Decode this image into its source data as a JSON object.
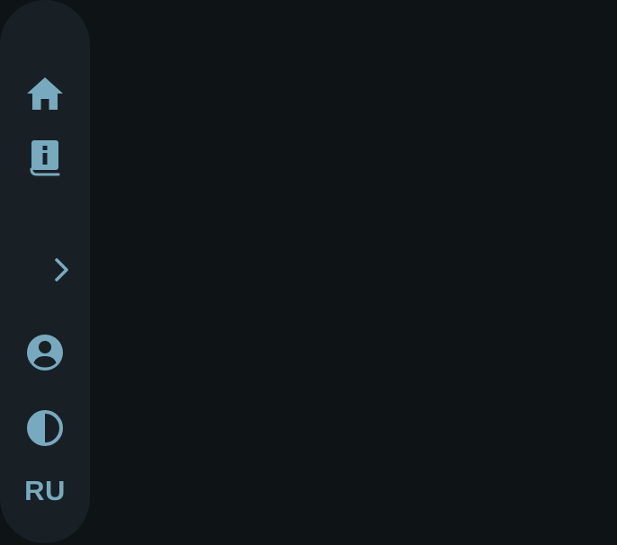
{
  "sidebar": {
    "items": [
      {
        "id": "home",
        "icon": "home-icon"
      },
      {
        "id": "info",
        "icon": "info-book-icon"
      },
      {
        "id": "expand",
        "icon": "chevron-right-icon"
      },
      {
        "id": "account",
        "icon": "account-circle-icon"
      },
      {
        "id": "theme",
        "icon": "contrast-icon"
      }
    ],
    "language": {
      "label": "RU"
    }
  },
  "colors": {
    "background": "#0e1316",
    "sidebar": "#182025",
    "accent": "#78aabf"
  }
}
